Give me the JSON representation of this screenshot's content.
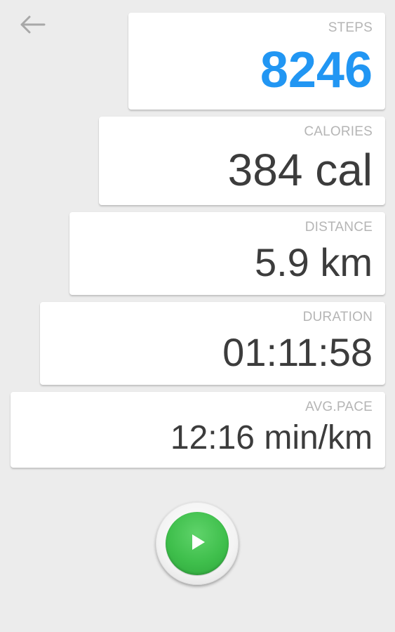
{
  "header": {
    "back_icon": "arrow-left-icon"
  },
  "stats": {
    "steps": {
      "label": "STEPS",
      "value": "8246"
    },
    "calories": {
      "label": "CALORIES",
      "value": "384 cal"
    },
    "distance": {
      "label": "DISTANCE",
      "value": "5.9 km"
    },
    "duration": {
      "label": "DURATION",
      "value": "01:11:58"
    },
    "pace": {
      "label": "AVG.PACE",
      "value": "12:16 min/km"
    }
  },
  "controls": {
    "play_icon": "play-icon"
  },
  "colors": {
    "background": "#ececec",
    "card": "#ffffff",
    "steps_accent": "#2196f3",
    "value_text": "#3c3c3c",
    "label_text": "#b5b5b5",
    "play_green": "#3fbf4c"
  }
}
